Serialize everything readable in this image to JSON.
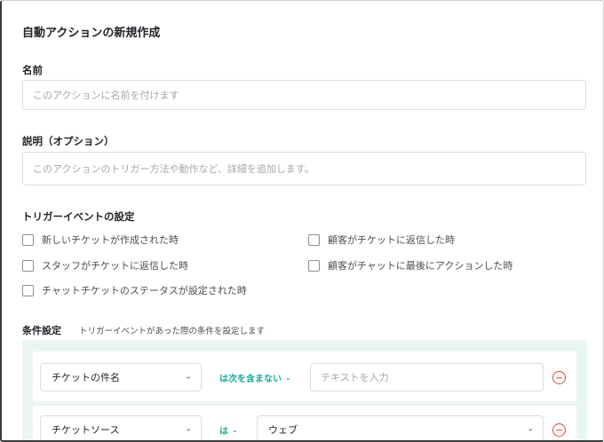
{
  "dialog": {
    "title": "自動アクションの新規作成"
  },
  "name_field": {
    "label": "名前",
    "placeholder": "このアクションに名前を付けます"
  },
  "description_field": {
    "label": "説明（オプション）",
    "placeholder": "このアクションのトリガー方法や動作など、詳細を追加します。"
  },
  "trigger": {
    "label": "トリガーイベントの設定",
    "options": [
      {
        "label": "新しいチケットが作成された時",
        "checked": false
      },
      {
        "label": "顧客がチケットに返信した時",
        "checked": false
      },
      {
        "label": "スタッフがチケットに返信した時",
        "checked": false
      },
      {
        "label": "顧客がチャットに最後にアクションした時",
        "checked": false
      },
      {
        "label": "チャットチケットのステータスが設定された時",
        "checked": false
      }
    ]
  },
  "conditions": {
    "label": "条件設定",
    "hint": "トリガーイベントがあった際の条件を設定します",
    "rows": [
      {
        "field": "チケットの件名",
        "operator": "は次を含まない",
        "value_placeholder": "テキストを入力"
      },
      {
        "field": "チケットソース",
        "operator": "は",
        "value": "ウェブ"
      }
    ]
  },
  "colors": {
    "accent": "#20a99b",
    "danger": "#e0453f",
    "panel_bg": "#e9f6f4"
  }
}
